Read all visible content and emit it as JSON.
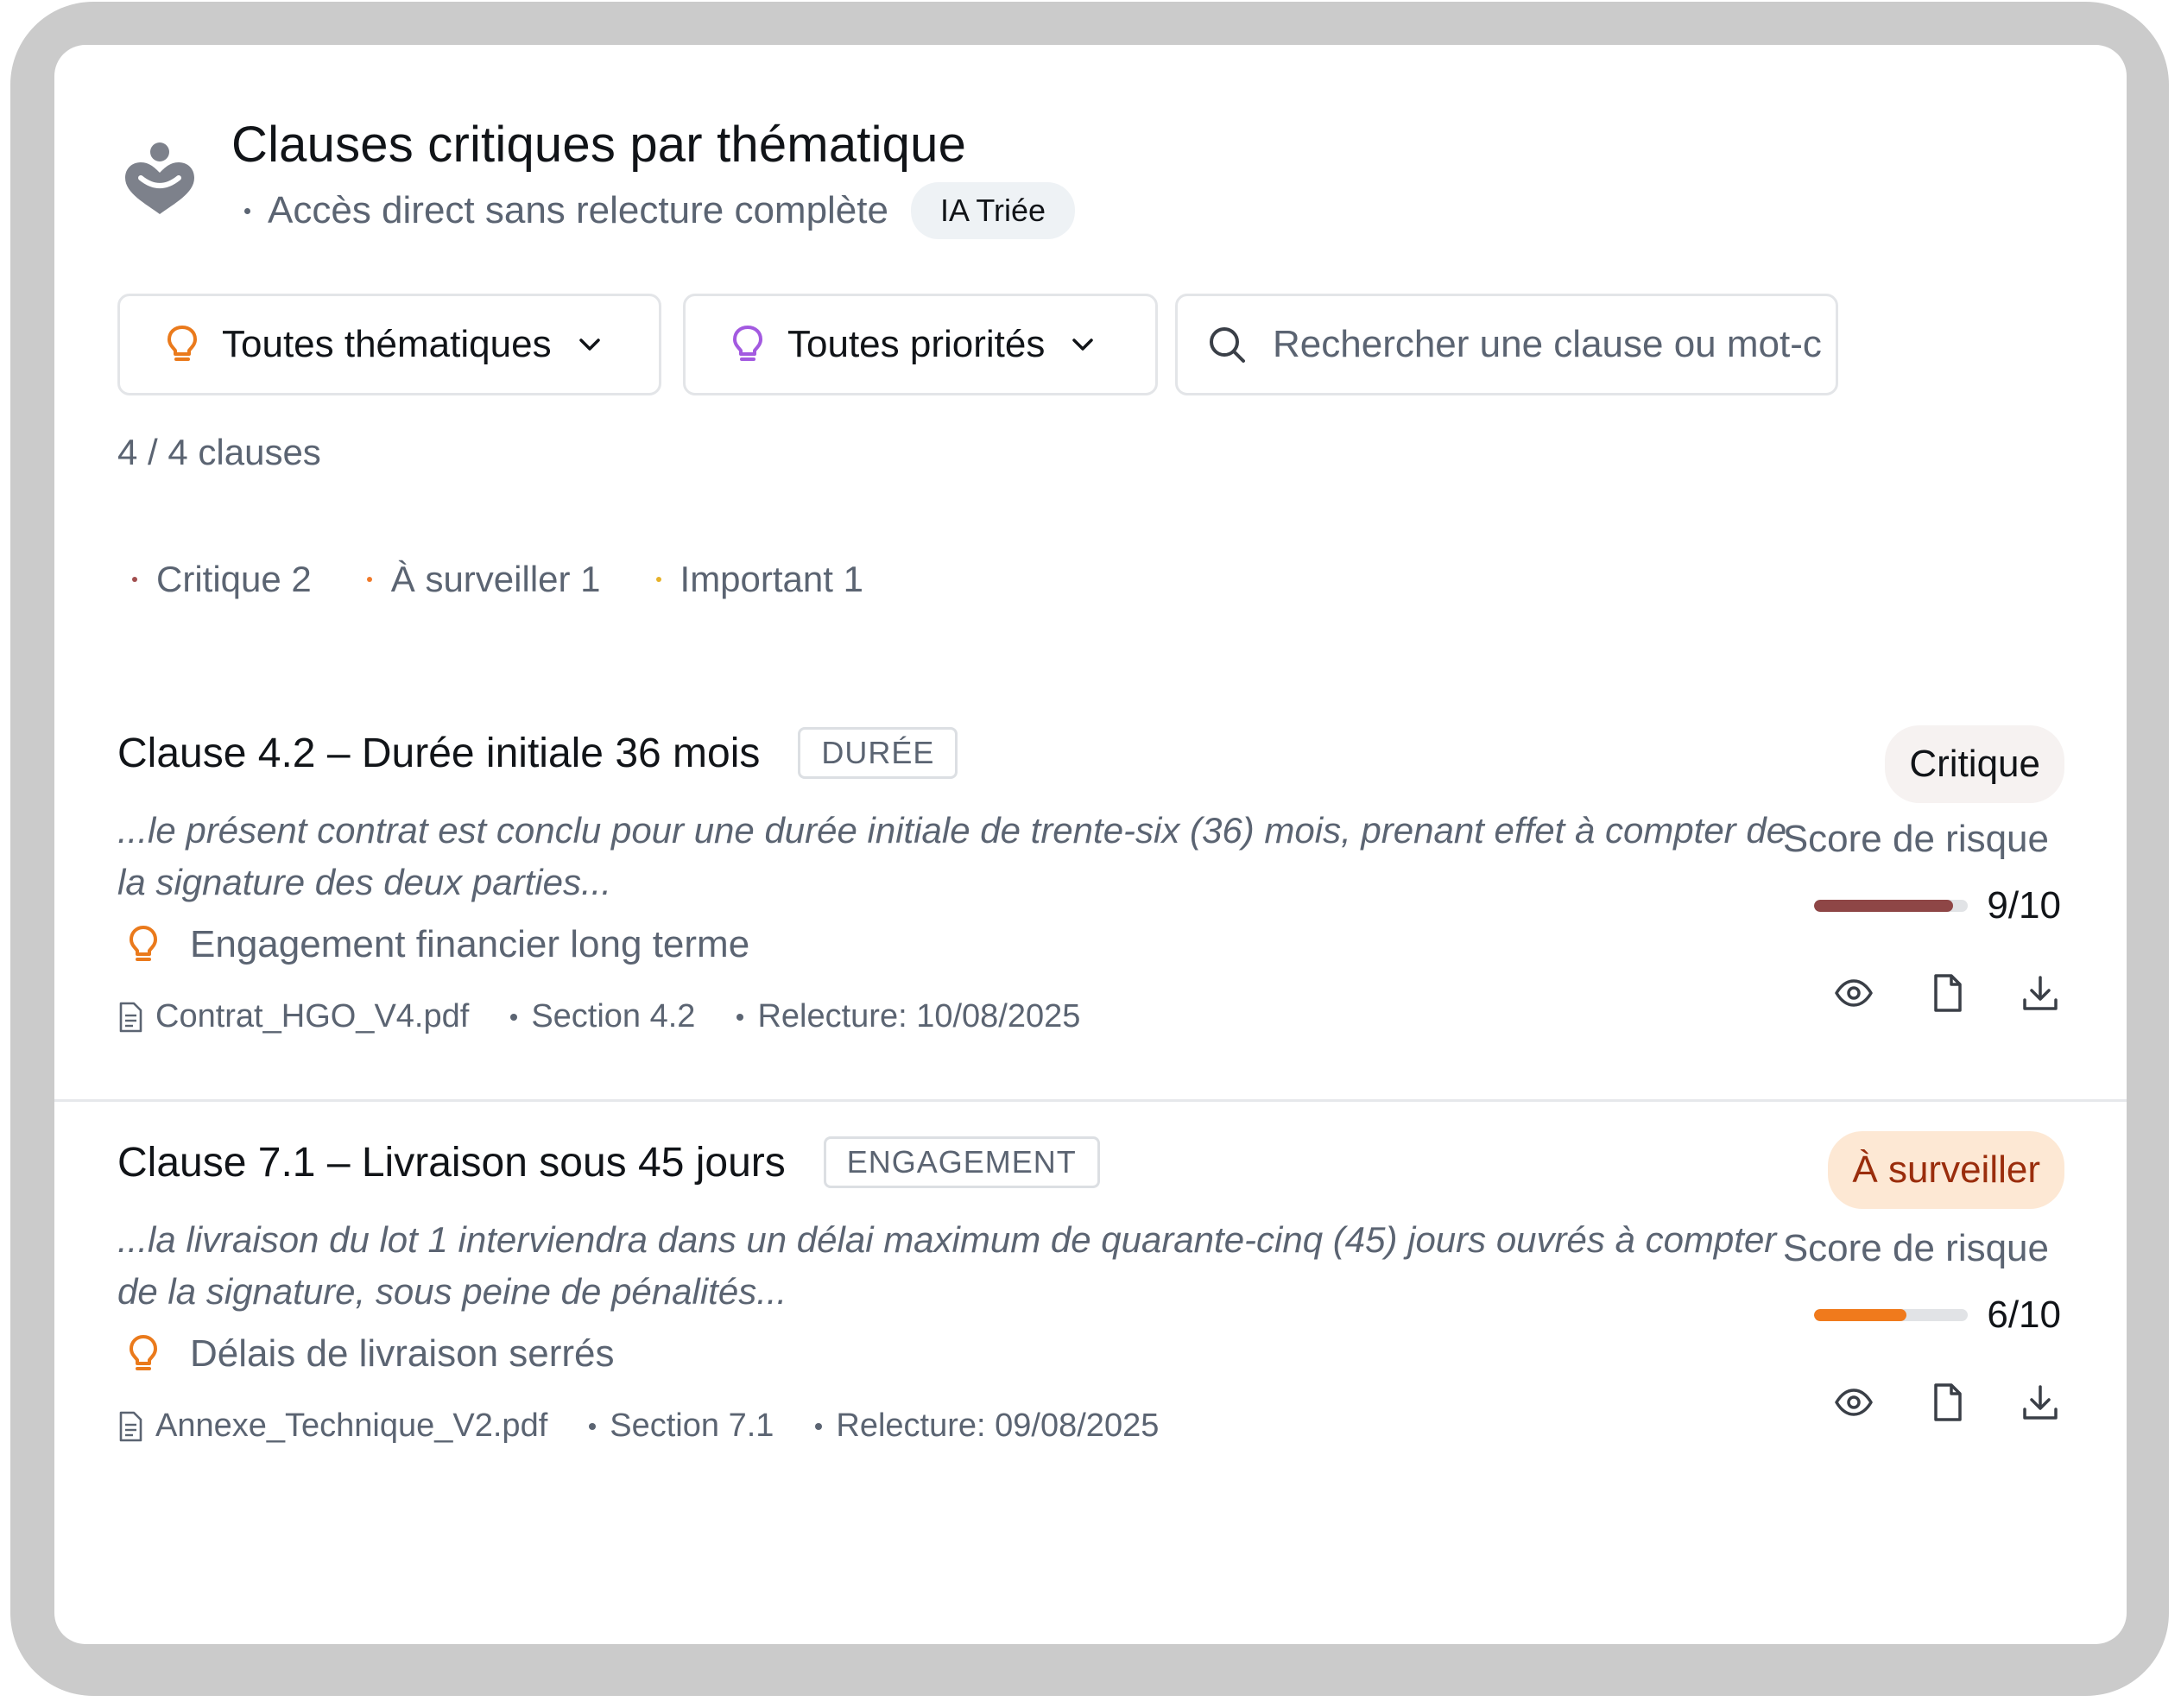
{
  "header": {
    "title": "Clauses critiques par thématique",
    "subtitle": "Accès direct sans relecture complète",
    "badge": "IA Triée",
    "logo_icon": "heart-person-icon"
  },
  "filters": {
    "thematique": {
      "label": "Toutes thématiques",
      "icon": "lightbulb-icon",
      "icon_color": "#ea7a1c"
    },
    "priorite": {
      "label": "Toutes priorités",
      "icon": "lightbulb-icon",
      "icon_color": "#a35ae0"
    },
    "search": {
      "placeholder": "Rechercher une clause ou mot-c",
      "value": ""
    }
  },
  "count_label": "4 / 4 clauses",
  "legend": [
    {
      "label": "Critique 2",
      "color": "#a24f4f"
    },
    {
      "label": "À surveiller 1",
      "color": "#f07a2a"
    },
    {
      "label": "Important 1",
      "color": "#e7b22a"
    }
  ],
  "clauses": [
    {
      "title": "Clause 4.2 – Durée initiale 36 mois",
      "tag": "DURÉE",
      "excerpt": "...le présent contrat est conclu pour une durée initiale de trente-six (36) mois, prenant effet à compter de la signature des deux parties...",
      "insight": "Engagement financier long terme",
      "file": "Contrat_HGO_V4.pdf",
      "section": "Section 4.2",
      "review": "Relecture: 10/08/2025",
      "status": "Critique",
      "score_label": "Score de risque",
      "score": 9,
      "score_text": "9/10",
      "score_color": "#8e4646"
    },
    {
      "title": "Clause 7.1 – Livraison sous 45 jours",
      "tag": "ENGAGEMENT",
      "excerpt": "...la livraison du lot 1 interviendra dans un délai maximum de quarante-cinq (45) jours ouvrés à compter de la signature, sous peine de pénalités...",
      "insight": "Délais de livraison serrés",
      "file": "Annexe_Technique_V2.pdf",
      "section": "Section 7.1",
      "review": "Relecture: 09/08/2025",
      "status": "À surveiller",
      "score_label": "Score de risque",
      "score": 6,
      "score_text": "6/10",
      "score_color": "#f07a1c"
    }
  ],
  "actions": [
    "eye-icon",
    "document-icon",
    "download-icon"
  ]
}
